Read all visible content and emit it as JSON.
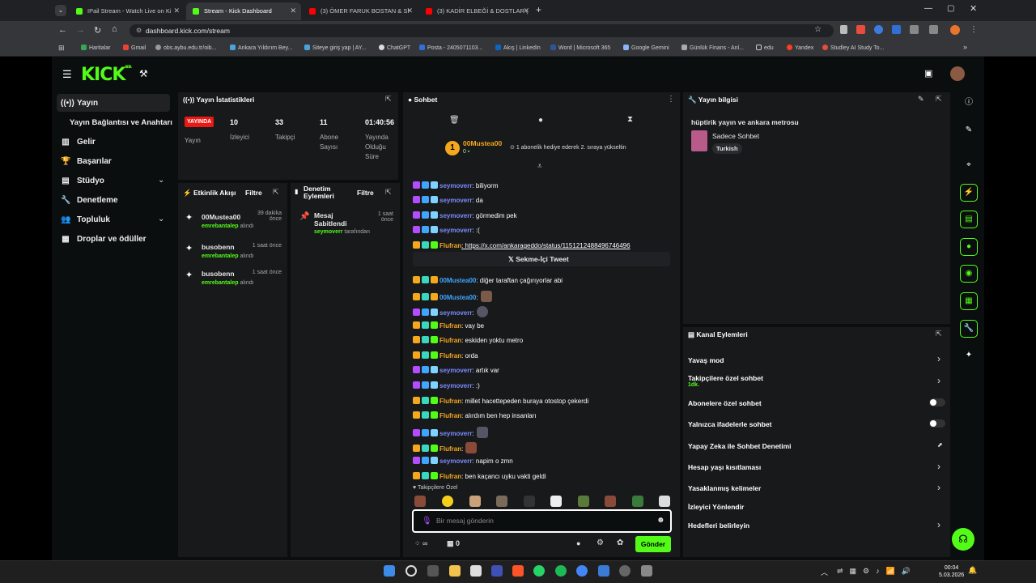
{
  "browser": {
    "tabs": [
      {
        "label": "IPail Stream - Watch Live on Ki",
        "color": "#53fc18"
      },
      {
        "label": "Stream - Kick Dashboard",
        "color": "#53fc18"
      },
      {
        "label": "(3) ÖMER FARUK BOSTAN & SI",
        "color": "#ff0000"
      },
      {
        "label": "(3) KADİR ELBEĞİ & DOSTLAR (",
        "color": "#ff0000"
      }
    ],
    "url": "dashboard.kick.com/stream",
    "bookmarks": [
      "Haritalar",
      "Gmail",
      "obs.aybu.edu.tr/oib...",
      "Ankara Yıldırım Bey...",
      "Siteye giriş yap | AY...",
      "ChatGPT",
      "Posta - 2405071103...",
      "Akış | LinkedIn",
      "Word | Microsoft 365",
      "Google Gemini",
      "Günlük Finans - Anl...",
      "edu",
      "Yandex",
      "Studley AI Study To..."
    ]
  },
  "header": {
    "logo": "KICK",
    "beta": "BETA"
  },
  "sidebar": {
    "items": [
      "Yayın",
      "Yayın Bağlantısı ve Anahtarı",
      "Gelir",
      "Başarılar",
      "Stüdyo",
      "Denetleme",
      "Topluluk",
      "Droplar ve ödüller"
    ]
  },
  "stats": {
    "title": "Yayın İstatistikleri",
    "live": "YAYINDA",
    "status_label": "Yayın",
    "items": [
      {
        "value": "10",
        "label": "İzleyici"
      },
      {
        "value": "33",
        "label": "Takipçi"
      },
      {
        "value": "11",
        "label": "Abone Sayısı"
      },
      {
        "value": "01:40:56",
        "label": "Yayında Olduğu Süre"
      }
    ]
  },
  "activity": {
    "title": "Etkinlik Akışı",
    "filter": "Filtre",
    "items": [
      {
        "name": "00Mustea00",
        "sub": "emrebantalep",
        "action": "alındı",
        "time": "39 dakika önce"
      },
      {
        "name": "busobenn",
        "sub": "emrebantalep",
        "action": "alındı",
        "time": "1 saat önce"
      },
      {
        "name": "busobenn",
        "sub": "emrebantalep",
        "action": "alındı",
        "time": "1 saat önce"
      }
    ]
  },
  "moderation": {
    "title": "Denetim Eylemleri",
    "filter": "Filtre",
    "item": {
      "title": "Mesaj Sabitlendi",
      "time": "1 saat önce",
      "user": "seymoverr",
      "action": "tarafından"
    }
  },
  "chat": {
    "title": "Sohbet",
    "pinned_user": "00Mustea00",
    "pinned_text": "1 abonelik hediye ederek 2. sıraya yükseltin",
    "pinned_count": "0",
    "tweet_label": "Sekme-İçi Tweet",
    "followers_only": "Takipçilere Özel",
    "placeholder": "Bir mesaj gönderin",
    "send": "Gönder",
    "count_a": "∞",
    "count_b": "0",
    "messages": [
      {
        "user": "seymoverr",
        "text": ": biliyorm",
        "kind": "sey"
      },
      {
        "user": "seymoverr",
        "text": ": da",
        "kind": "sey"
      },
      {
        "user": "seymoverr",
        "text": ": görmedim pek",
        "kind": "sey"
      },
      {
        "user": "seymoverr",
        "text": ": :(",
        "kind": "sey"
      },
      {
        "user": "Flufran",
        "text": ": https://x.com/ankarageddo/status/1151212488496746496",
        "kind": "flu"
      },
      {
        "user": "00Mustea00",
        "text": ": diğer taraftan çağırıyorlar abi",
        "kind": "mus"
      },
      {
        "user": "00Mustea00",
        "text": ":",
        "kind": "mus"
      },
      {
        "user": "seymoverr",
        "text": ":",
        "kind": "sey"
      },
      {
        "user": "Flufran",
        "text": ": vay be",
        "kind": "flu"
      },
      {
        "user": "Flufran",
        "text": ": eskiden yoktu metro",
        "kind": "flu"
      },
      {
        "user": "Flufran",
        "text": ": orda",
        "kind": "flu"
      },
      {
        "user": "seymoverr",
        "text": ": artık var",
        "kind": "sey"
      },
      {
        "user": "seymoverr",
        "text": ": :)",
        "kind": "sey"
      },
      {
        "user": "Flufran",
        "text": ": millet hacettepeden buraya otostop çekerdi",
        "kind": "flu"
      },
      {
        "user": "Flufran",
        "text": ": alırdım ben hep insanları",
        "kind": "flu"
      },
      {
        "user": "seymoverr",
        "text": ":",
        "kind": "sey"
      },
      {
        "user": "Flufran",
        "text": ":",
        "kind": "flu"
      },
      {
        "user": "seymoverr",
        "text": ": napim o zmn",
        "kind": "sey"
      },
      {
        "user": "Flufran",
        "text": ": ben kaçancı uyku vakti geldi",
        "kind": "flu"
      }
    ]
  },
  "info": {
    "title": "Yayın bilgisi",
    "stream_title": "hüptirik yayın ve ankara metrosu",
    "category": "Sadece Sohbet",
    "language": "Turkish"
  },
  "actions": {
    "title": "Kanal Eylemleri",
    "items": [
      {
        "label": "Yavaş mod",
        "control": "chevron"
      },
      {
        "label": "Takipçilere özel sohbet",
        "sub": "1dk.",
        "control": "chevron"
      },
      {
        "label": "Abonelere özel sohbet",
        "control": "toggle"
      },
      {
        "label": "Yalnızca ifadelerle sohbet",
        "control": "toggle"
      },
      {
        "label": "Yapay Zeka ile Sohbet Denetimi",
        "control": "external"
      },
      {
        "label": "Hesap yaşı kısıtlaması",
        "control": "chevron"
      },
      {
        "label": "Yasaklanmış kelimeler",
        "control": "chevron"
      },
      {
        "label": "İzleyici Yönlendir",
        "control": "none"
      },
      {
        "label": "Hedefleri belirleyin",
        "control": "chevron"
      }
    ]
  },
  "taskbar": {
    "time": "00:04",
    "date": "5.03.2026"
  },
  "colors": {
    "accent": "#53fc18",
    "live": "#e91916",
    "panel": "#18191b",
    "bg": "#0b0e0f"
  }
}
